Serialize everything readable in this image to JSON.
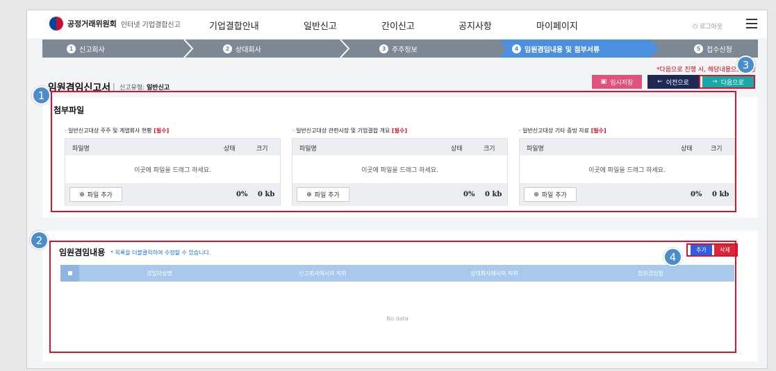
{
  "header": {
    "org_name": "공정거래위원회",
    "service_name": "인터넷 기업결합신고",
    "menu": [
      "기업결합안내",
      "일반신고",
      "간이신고",
      "공지사항",
      "마이페이지"
    ],
    "logout_label": "로그아웃"
  },
  "steps": [
    {
      "num": "1",
      "label": "신고회사"
    },
    {
      "num": "2",
      "label": "상대회사"
    },
    {
      "num": "3",
      "label": "주주정보"
    },
    {
      "num": "4",
      "label": "임원겸임내용 및 첨부서류"
    },
    {
      "num": "5",
      "label": "접수신청"
    }
  ],
  "page": {
    "title": "임원겸임신고서",
    "report_type_label": "신고유형:",
    "report_type_value": "일반신고",
    "notice": "*다음으로 진행 시, 해당내용으로 저장",
    "save_label": "임시저장",
    "prev_label": "이전으로",
    "next_label": "다음으로"
  },
  "attachments": {
    "title": "첨부파일",
    "columns": [
      {
        "title": "· 일반신고대상 주주 및 계열회사 현황",
        "required": "[필수]"
      },
      {
        "title": "· 일반신고대상 관련시장 및 기업결합 개요",
        "required": "[필수]"
      },
      {
        "title": "· 일반신고대상 기타 증빙 자료",
        "required": "[필수]"
      }
    ],
    "head_name": "파일명",
    "head_status": "상태",
    "head_size": "크기",
    "drop_text": "이곳에 파일을 드래그 하세요.",
    "add_file_label": "파일 추가",
    "percent": "0%",
    "size": "0 kb"
  },
  "concurrent": {
    "title": "임원겸임내용",
    "hint": "* 목록을 더블클릭하여 수정할 수 있습니다.",
    "add_label": "추가",
    "delete_label": "삭제",
    "columns": [
      "겸임자성명",
      "신고회사에서의 직위",
      "상대회사에서의 직위",
      "임원겸임일"
    ],
    "empty_text": "No data"
  },
  "callouts": [
    "1",
    "2",
    "3",
    "4"
  ],
  "colors": {
    "step_bar": "#7d8894",
    "step_active": "#4a8fe0",
    "highlight": "#e0102a",
    "save_button": "#e0517c",
    "prev_button": "#1e2a55",
    "next_button": "#19a8a8",
    "grid_header": "#a8c9ec",
    "callout": "#4a8ccc"
  }
}
